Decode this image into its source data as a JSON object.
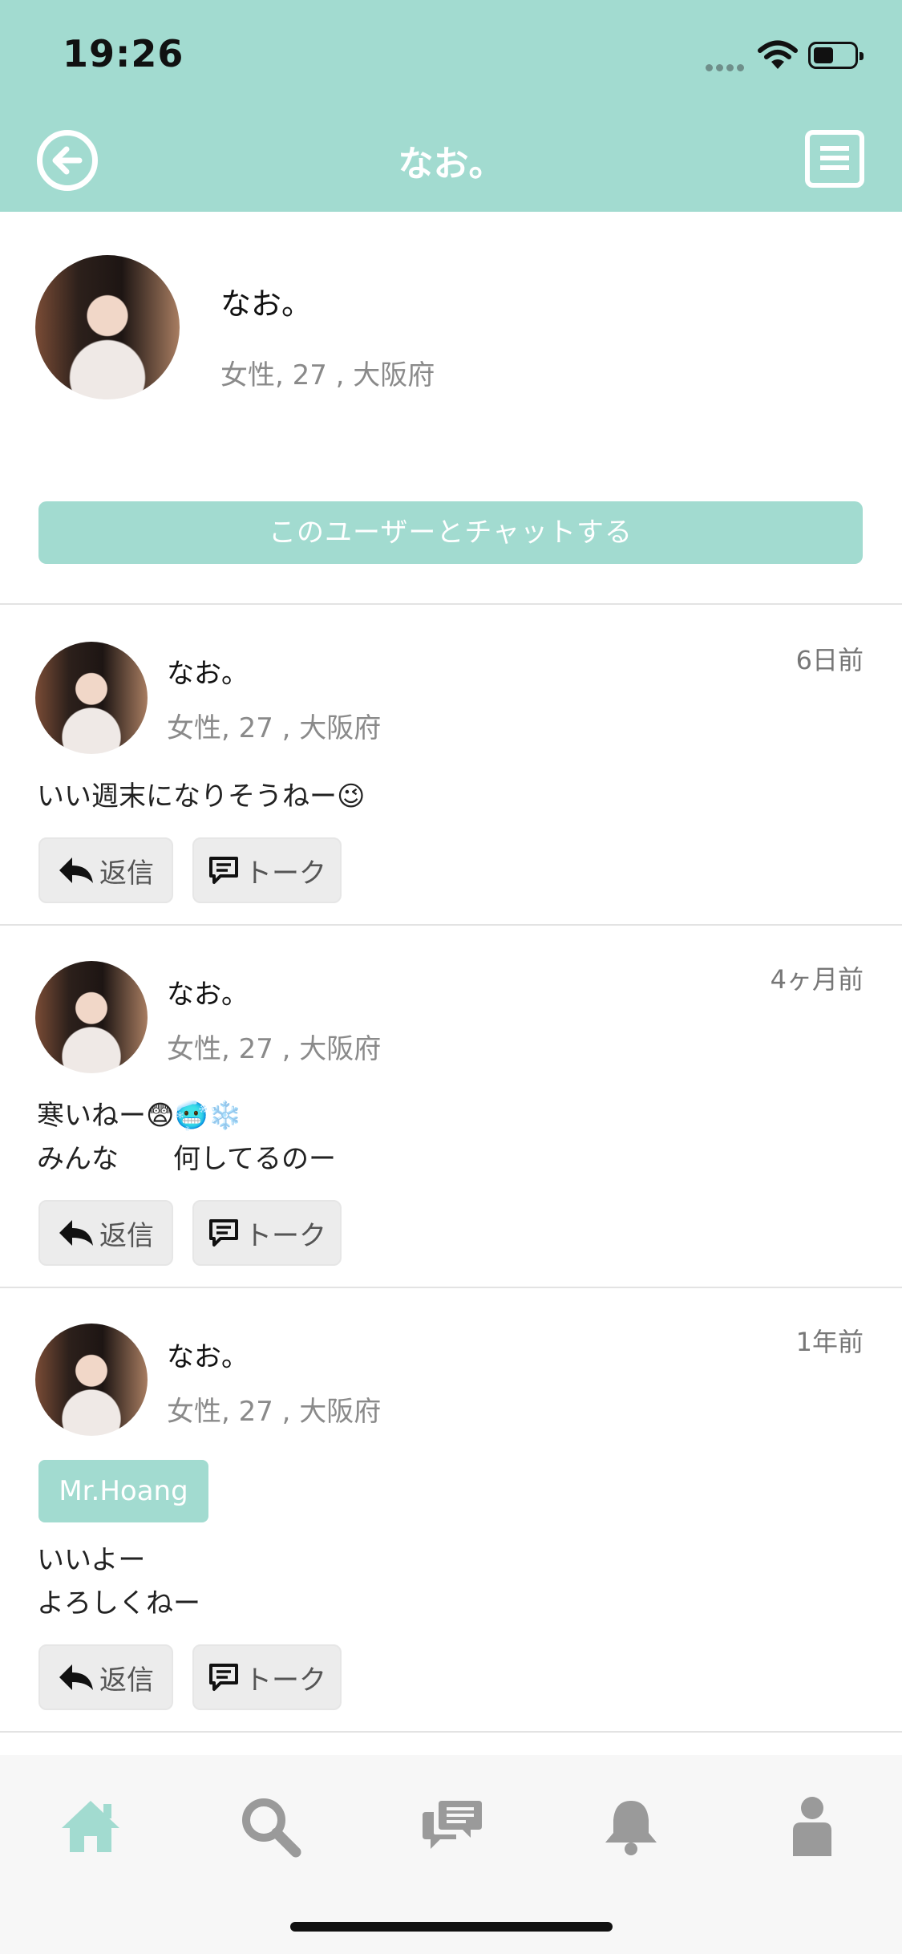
{
  "status_bar": {
    "time": "19:26"
  },
  "header": {
    "title": "なお。"
  },
  "profile": {
    "name": "なお。",
    "meta": "女性, 27 , 大阪府",
    "chat_button_label": "このユーザーとチャットする"
  },
  "posts": [
    {
      "name": "なお。",
      "meta": "女性, 27 , 大阪府",
      "time": "6日前",
      "text": "いい週末になりそうねー😉",
      "reply_label": "返信",
      "talk_label": "トーク"
    },
    {
      "name": "なお。",
      "meta": "女性, 27 , 大阪府",
      "time": "4ヶ月前",
      "text": "寒いねー😨🥶❄️\nみんな　　何してるのー",
      "reply_label": "返信",
      "talk_label": "トーク"
    },
    {
      "name": "なお。",
      "meta": "女性, 27 , 大阪府",
      "time": "1年前",
      "tag": "Mr.Hoang",
      "text": "いいよー\nよろしくねー",
      "reply_label": "返信",
      "talk_label": "トーク"
    }
  ],
  "tab_bar": {
    "items": [
      "home-icon",
      "search-icon",
      "chat-icon",
      "bell-icon",
      "person-icon"
    ],
    "active": "home-icon"
  },
  "colors": {
    "accent": "#a2dbd0",
    "tab_inactive": "#9a9a9a"
  }
}
